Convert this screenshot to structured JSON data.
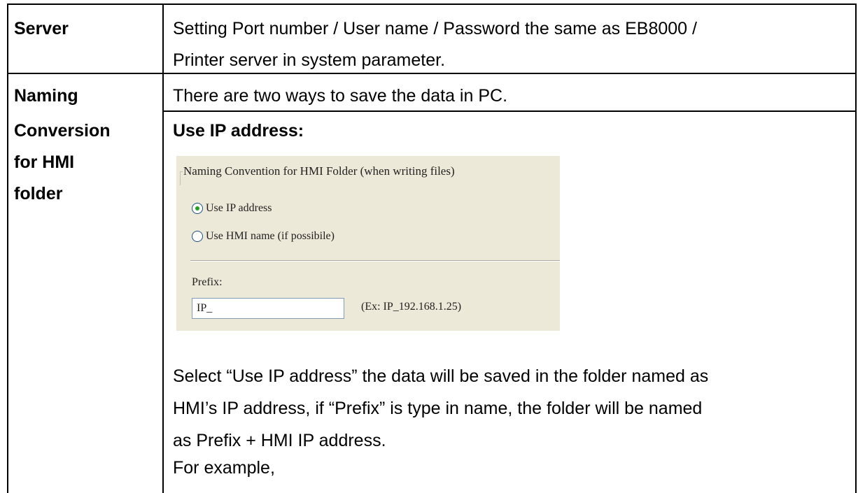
{
  "rows": {
    "server": {
      "label": "Server",
      "desc_line1": "Setting Port number / User name / Password the same as EB8000 /",
      "desc_line2": "Printer server in system parameter."
    },
    "naming": {
      "label_line1": "Naming",
      "label_line2": "Conversion",
      "label_line3": "for HMI",
      "label_line4": "folder",
      "intro": "There are two ways to save the data in PC.",
      "heading": "Use IP address:",
      "para_line1": "Select “Use IP address” the data will be saved in the folder named as",
      "para_line2": "HMI’s IP address, if “Prefix” is type in name, the folder will be named",
      "para_line3": "as Prefix + HMI IP address.",
      "para_line4": "For example,"
    }
  },
  "dialog": {
    "group_title": "Naming Convention for HMI Folder (when writing files)",
    "option_ip": "Use IP address",
    "option_hmi": "Use HMI name (if possibile)",
    "selected": "Use IP address",
    "prefix_label": "Prefix:",
    "prefix_value": "IP_",
    "example": "(Ex: IP_192.168.1.25)"
  }
}
